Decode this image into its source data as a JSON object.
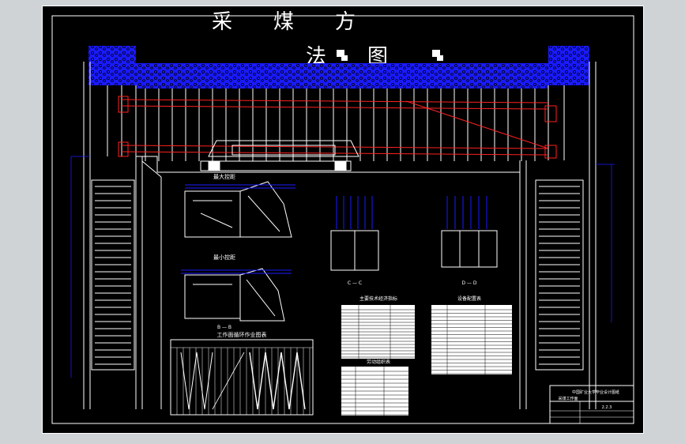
{
  "drawing": {
    "title_line1": "采　　煤　　方",
    "title_line2": "法　　图",
    "colors": {
      "background": "#000000",
      "linework": "#ffffff",
      "coal_seam": "#1a1aff",
      "cutter_path": "#ff2020",
      "page": "#cfd3d6"
    }
  },
  "views": {
    "view1_label": "最大控距",
    "view2_label": "最小控距",
    "view2_section": "B — B",
    "section_c": "C — C",
    "section_d": "D — D"
  },
  "chart": {
    "title": "工作面循环作业图表"
  },
  "tables": {
    "table1_title": "主要技术经济指标",
    "table2_title": "劳动组织表",
    "table3_title": "设备配置表"
  },
  "title_block": {
    "line1": "中国矿业大学毕业设计图纸",
    "line2": "采煤工作面",
    "drawing_no": "2.2.3"
  }
}
